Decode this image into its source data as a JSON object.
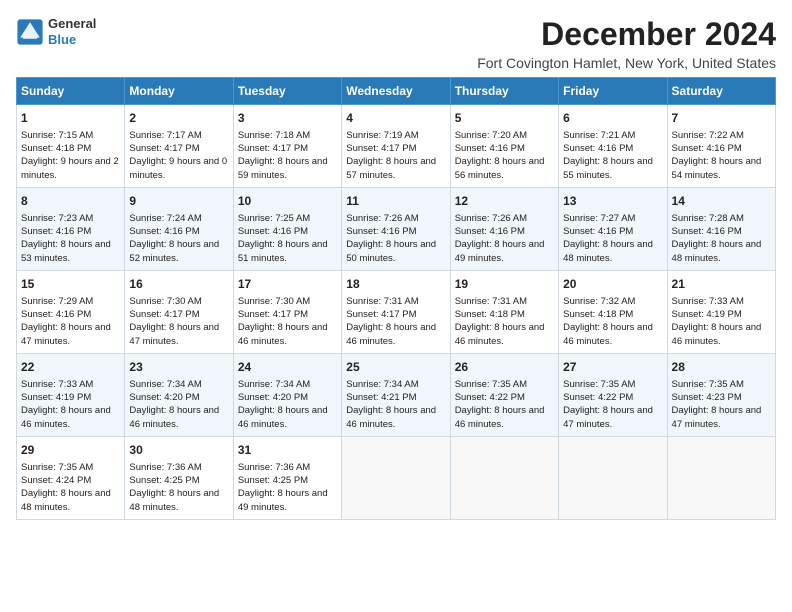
{
  "header": {
    "logo_line1": "General",
    "logo_line2": "Blue",
    "title": "December 2024",
    "subtitle": "Fort Covington Hamlet, New York, United States"
  },
  "columns": [
    "Sunday",
    "Monday",
    "Tuesday",
    "Wednesday",
    "Thursday",
    "Friday",
    "Saturday"
  ],
  "weeks": [
    [
      {
        "day": "1",
        "sunrise": "7:15 AM",
        "sunset": "4:18 PM",
        "daylight": "9 hours and 2 minutes."
      },
      {
        "day": "2",
        "sunrise": "7:17 AM",
        "sunset": "4:17 PM",
        "daylight": "9 hours and 0 minutes."
      },
      {
        "day": "3",
        "sunrise": "7:18 AM",
        "sunset": "4:17 PM",
        "daylight": "8 hours and 59 minutes."
      },
      {
        "day": "4",
        "sunrise": "7:19 AM",
        "sunset": "4:17 PM",
        "daylight": "8 hours and 57 minutes."
      },
      {
        "day": "5",
        "sunrise": "7:20 AM",
        "sunset": "4:16 PM",
        "daylight": "8 hours and 56 minutes."
      },
      {
        "day": "6",
        "sunrise": "7:21 AM",
        "sunset": "4:16 PM",
        "daylight": "8 hours and 55 minutes."
      },
      {
        "day": "7",
        "sunrise": "7:22 AM",
        "sunset": "4:16 PM",
        "daylight": "8 hours and 54 minutes."
      }
    ],
    [
      {
        "day": "8",
        "sunrise": "7:23 AM",
        "sunset": "4:16 PM",
        "daylight": "8 hours and 53 minutes."
      },
      {
        "day": "9",
        "sunrise": "7:24 AM",
        "sunset": "4:16 PM",
        "daylight": "8 hours and 52 minutes."
      },
      {
        "day": "10",
        "sunrise": "7:25 AM",
        "sunset": "4:16 PM",
        "daylight": "8 hours and 51 minutes."
      },
      {
        "day": "11",
        "sunrise": "7:26 AM",
        "sunset": "4:16 PM",
        "daylight": "8 hours and 50 minutes."
      },
      {
        "day": "12",
        "sunrise": "7:26 AM",
        "sunset": "4:16 PM",
        "daylight": "8 hours and 49 minutes."
      },
      {
        "day": "13",
        "sunrise": "7:27 AM",
        "sunset": "4:16 PM",
        "daylight": "8 hours and 48 minutes."
      },
      {
        "day": "14",
        "sunrise": "7:28 AM",
        "sunset": "4:16 PM",
        "daylight": "8 hours and 48 minutes."
      }
    ],
    [
      {
        "day": "15",
        "sunrise": "7:29 AM",
        "sunset": "4:16 PM",
        "daylight": "8 hours and 47 minutes."
      },
      {
        "day": "16",
        "sunrise": "7:30 AM",
        "sunset": "4:17 PM",
        "daylight": "8 hours and 47 minutes."
      },
      {
        "day": "17",
        "sunrise": "7:30 AM",
        "sunset": "4:17 PM",
        "daylight": "8 hours and 46 minutes."
      },
      {
        "day": "18",
        "sunrise": "7:31 AM",
        "sunset": "4:17 PM",
        "daylight": "8 hours and 46 minutes."
      },
      {
        "day": "19",
        "sunrise": "7:31 AM",
        "sunset": "4:18 PM",
        "daylight": "8 hours and 46 minutes."
      },
      {
        "day": "20",
        "sunrise": "7:32 AM",
        "sunset": "4:18 PM",
        "daylight": "8 hours and 46 minutes."
      },
      {
        "day": "21",
        "sunrise": "7:33 AM",
        "sunset": "4:19 PM",
        "daylight": "8 hours and 46 minutes."
      }
    ],
    [
      {
        "day": "22",
        "sunrise": "7:33 AM",
        "sunset": "4:19 PM",
        "daylight": "8 hours and 46 minutes."
      },
      {
        "day": "23",
        "sunrise": "7:34 AM",
        "sunset": "4:20 PM",
        "daylight": "8 hours and 46 minutes."
      },
      {
        "day": "24",
        "sunrise": "7:34 AM",
        "sunset": "4:20 PM",
        "daylight": "8 hours and 46 minutes."
      },
      {
        "day": "25",
        "sunrise": "7:34 AM",
        "sunset": "4:21 PM",
        "daylight": "8 hours and 46 minutes."
      },
      {
        "day": "26",
        "sunrise": "7:35 AM",
        "sunset": "4:22 PM",
        "daylight": "8 hours and 46 minutes."
      },
      {
        "day": "27",
        "sunrise": "7:35 AM",
        "sunset": "4:22 PM",
        "daylight": "8 hours and 47 minutes."
      },
      {
        "day": "28",
        "sunrise": "7:35 AM",
        "sunset": "4:23 PM",
        "daylight": "8 hours and 47 minutes."
      }
    ],
    [
      {
        "day": "29",
        "sunrise": "7:35 AM",
        "sunset": "4:24 PM",
        "daylight": "8 hours and 48 minutes."
      },
      {
        "day": "30",
        "sunrise": "7:36 AM",
        "sunset": "4:25 PM",
        "daylight": "8 hours and 48 minutes."
      },
      {
        "day": "31",
        "sunrise": "7:36 AM",
        "sunset": "4:25 PM",
        "daylight": "8 hours and 49 minutes."
      },
      null,
      null,
      null,
      null
    ]
  ]
}
